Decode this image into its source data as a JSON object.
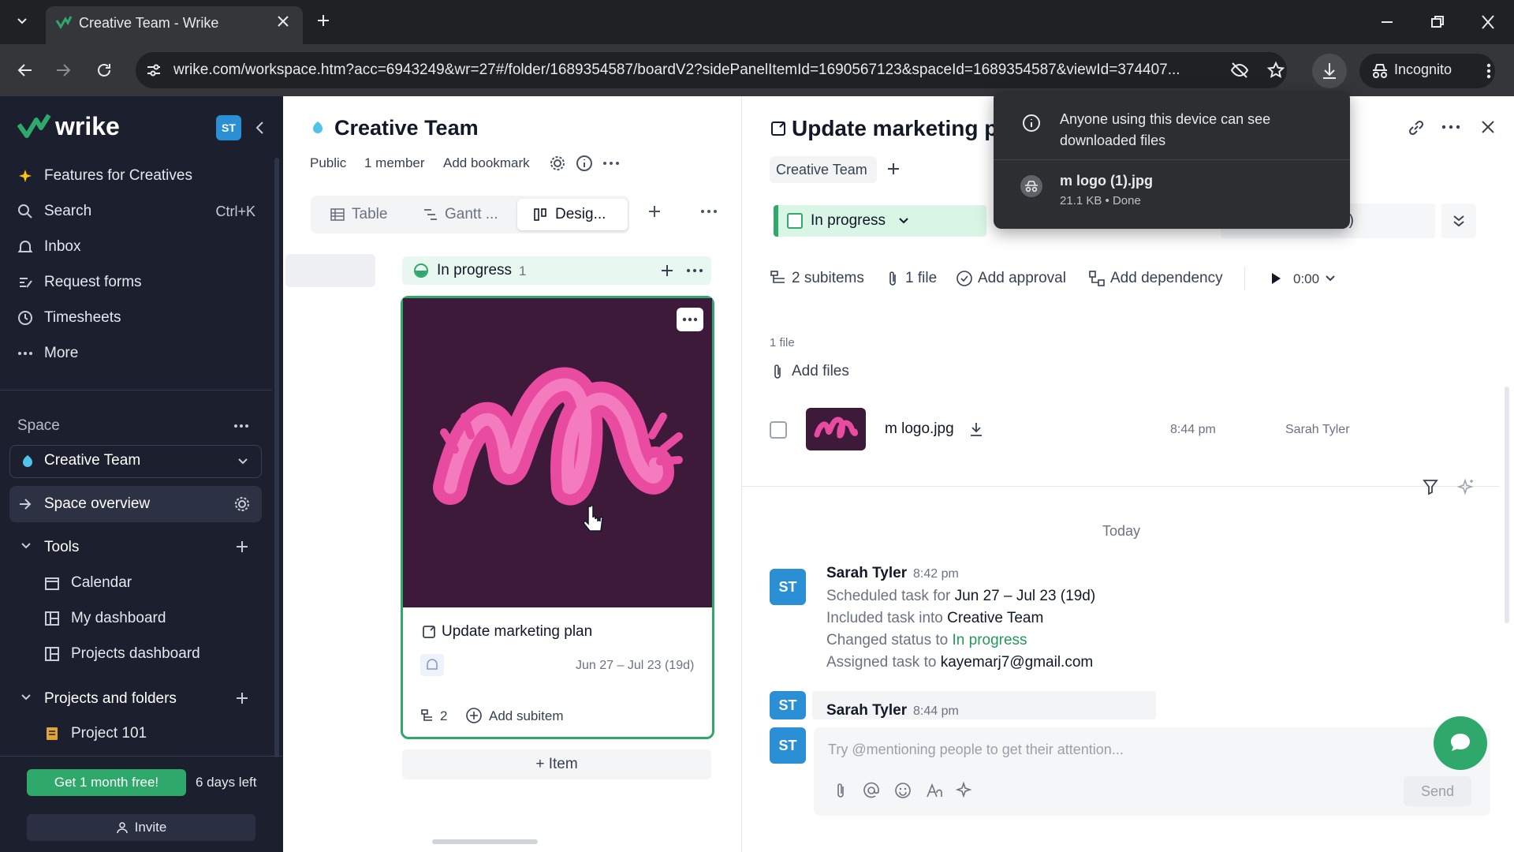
{
  "browser": {
    "tab_title": "Creative Team - Wrike",
    "url": "wrike.com/workspace.htm?acc=6943249&wr=27#/folder/1689354587/boardV2?sidePanelItemId=1690567123&spaceId=1689354587&viewId=374407...",
    "incognito_label": "Incognito"
  },
  "download_popup": {
    "notice": "Anyone using this device can see downloaded files",
    "file_name": "m logo (1).jpg",
    "file_meta": "21.1 KB • Done"
  },
  "sidebar": {
    "logo": "wrike",
    "user_initials": "ST",
    "nav": [
      {
        "label": "Features for Creatives",
        "icon": "sparkle-icon"
      },
      {
        "label": "Search",
        "shortcut": "Ctrl+K",
        "icon": "search-icon"
      },
      {
        "label": "Inbox",
        "icon": "bell-icon"
      },
      {
        "label": "Request forms",
        "icon": "form-icon"
      },
      {
        "label": "Timesheets",
        "icon": "clock-icon"
      },
      {
        "label": "More",
        "icon": "more-icon"
      }
    ],
    "space_heading": "Space",
    "space_name": "Creative Team",
    "space_overview": "Space overview",
    "tools_heading": "Tools",
    "tools": [
      "Calendar",
      "My dashboard",
      "Projects dashboard"
    ],
    "projects_heading": "Projects and folders",
    "projects": [
      "Project 101"
    ],
    "trial_button": "Get 1 month free!",
    "trial_days": "6 days left",
    "invite": "Invite"
  },
  "board": {
    "title": "Creative Team",
    "meta": [
      "Public",
      "1 member",
      "Add bookmark"
    ],
    "tabs": [
      "Table",
      "Gantt ...",
      "Desig..."
    ],
    "column": {
      "status": "In progress",
      "count": "1"
    },
    "card": {
      "title": "Update marketing plan",
      "dates": "Jun 27 – Jul 23 (19d)",
      "subitems_count": "2",
      "add_subitem": "Add subitem"
    },
    "add_item": "+ Item"
  },
  "panel": {
    "title": "Update marketing p",
    "space_chip": "Creative Team",
    "status": "In progress",
    "hidden_tail": "d)",
    "actions": {
      "subitems": "2 subitems",
      "files": "1 file",
      "approval": "Add approval",
      "dependency": "Add dependency",
      "timer": "0:00"
    },
    "files_count": "1 file",
    "add_files": "Add files",
    "file": {
      "name": "m logo.jpg",
      "time": "8:44 pm",
      "author": "Sarah Tyler"
    },
    "day_divider": "Today",
    "activity": [
      {
        "initials": "ST",
        "author": "Sarah Tyler",
        "time": "8:42 pm",
        "lines": [
          {
            "text": "Scheduled task for ",
            "value": "Jun 27 – Jul 23 (19d)"
          },
          {
            "text": "Included task into ",
            "value": "Creative Team"
          },
          {
            "text": "Changed status to ",
            "value": "In progress"
          },
          {
            "text": "Assigned task to ",
            "value": "kayemarj7@gmail.com"
          }
        ]
      },
      {
        "initials": "ST",
        "author": "Sarah Tyler",
        "time": "8:44 pm"
      }
    ],
    "comment_placeholder": "Try @mentioning people to get their attention...",
    "comment_avatar": "ST",
    "send": "Send"
  },
  "colors": {
    "brand_green": "#2ea86b",
    "sidebar_bg": "#1b1f2e",
    "avatar_blue": "#2b8fd6",
    "status_bg": "#d8f5e6",
    "logo_pink": "#e84ba0"
  }
}
